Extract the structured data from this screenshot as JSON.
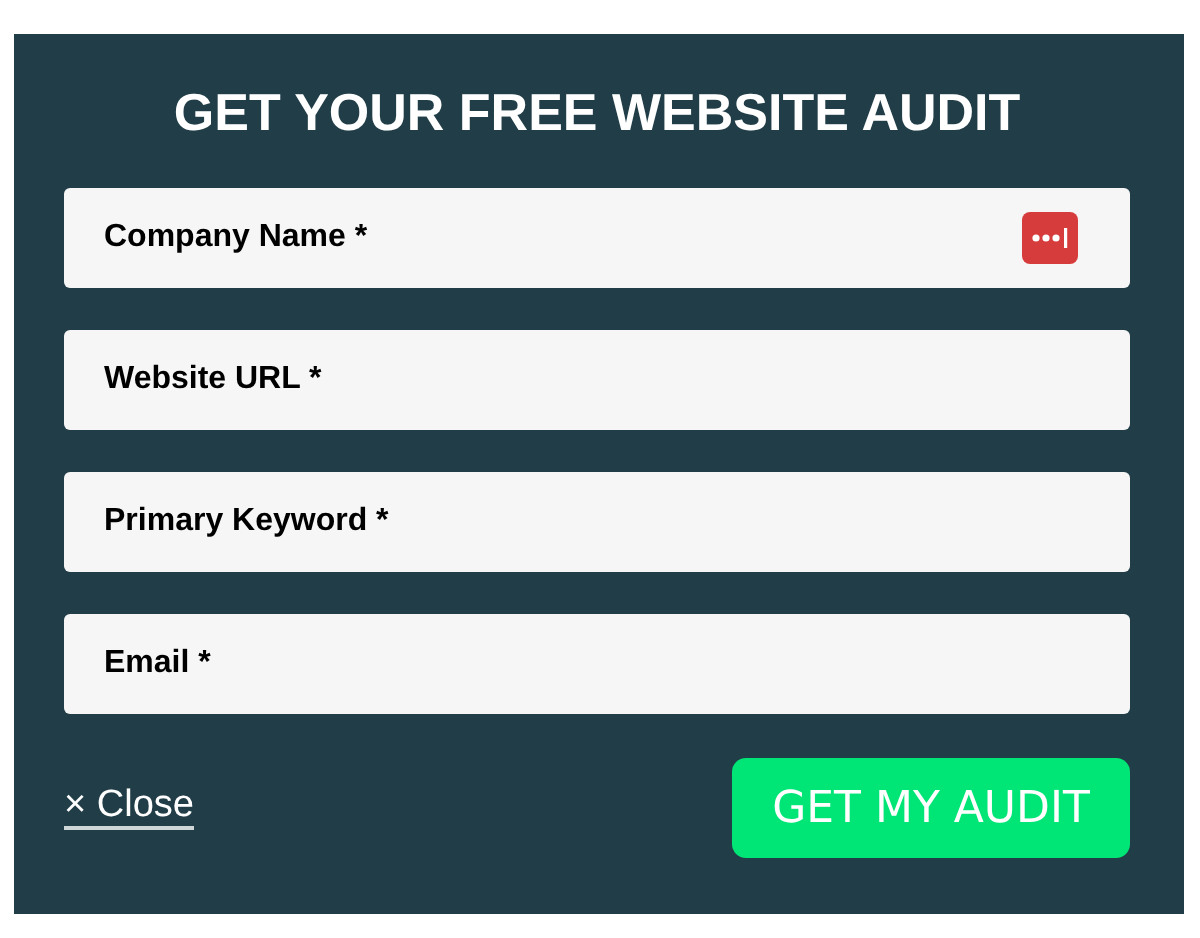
{
  "title": "GET YOUR FREE WEBSITE AUDIT",
  "fields": [
    {
      "placeholder": "Company Name *",
      "password_icon": true
    },
    {
      "placeholder": "Website URL *",
      "password_icon": false
    },
    {
      "placeholder": "Primary Keyword *",
      "password_icon": false
    },
    {
      "placeholder": "Email *",
      "password_icon": false
    }
  ],
  "close_link": "× Close",
  "submit_button": "GET MY AUDIT"
}
